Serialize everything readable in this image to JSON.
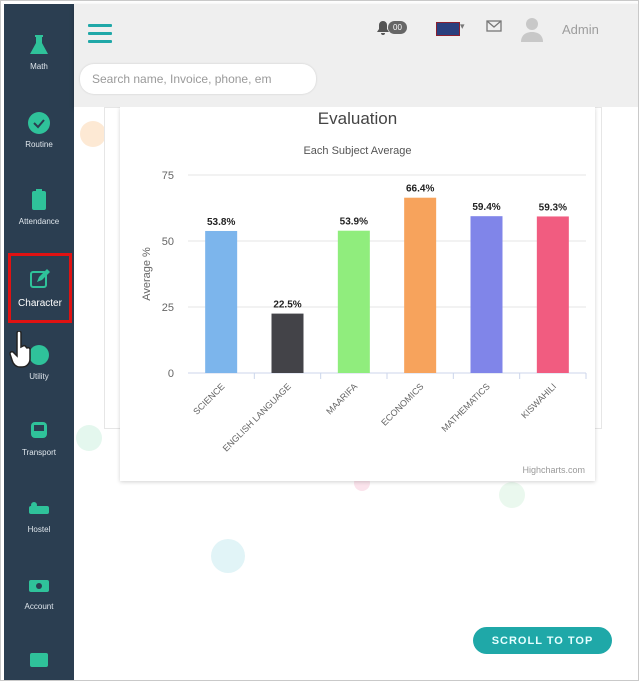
{
  "sidebar": {
    "items": [
      {
        "label": "Math",
        "icon": "flask-icon"
      },
      {
        "label": "Routine",
        "icon": "check-circle-icon"
      },
      {
        "label": "Attendance",
        "icon": "clipboard-icon"
      },
      {
        "label": "Character",
        "icon": "edit-icon",
        "active": true
      },
      {
        "label": "Utility",
        "icon": "globe-icon"
      },
      {
        "label": "Transport",
        "icon": "bus-icon"
      },
      {
        "label": "Hostel",
        "icon": "bed-icon"
      },
      {
        "label": "Account",
        "icon": "money-icon"
      }
    ]
  },
  "header": {
    "search_placeholder": "Search name, Invoice, phone, em",
    "notification_count": "00",
    "user_name": "Admin"
  },
  "card": {
    "title": "Evaluation",
    "credit": "Highcharts.com"
  },
  "chart_data": {
    "type": "bar",
    "title": "Each Subject Average",
    "ylabel": "Average %",
    "ylim": [
      0,
      75
    ],
    "yticks": [
      0,
      25,
      50,
      75
    ],
    "categories": [
      "SCIENCE",
      "ENGLISH LANGUAGE",
      "MAARIFA",
      "ECONOMICS",
      "MATHEMATICS",
      "KISWAHILI"
    ],
    "values": [
      53.8,
      22.5,
      53.9,
      66.4,
      59.4,
      59.3
    ],
    "labels": [
      "53.8%",
      "22.5%",
      "53.9%",
      "66.4%",
      "59.4%",
      "59.3%"
    ],
    "colors": [
      "#7cb5ec",
      "#434348",
      "#90ed7d",
      "#f7a35c",
      "#8085e9",
      "#f15c80"
    ],
    "grid": true
  },
  "scroll_top_label": "SCROLL TO TOP",
  "colors": {
    "sidebar": "#2b3e51",
    "accent": "#20a8a8",
    "highlight": "#e01212"
  }
}
